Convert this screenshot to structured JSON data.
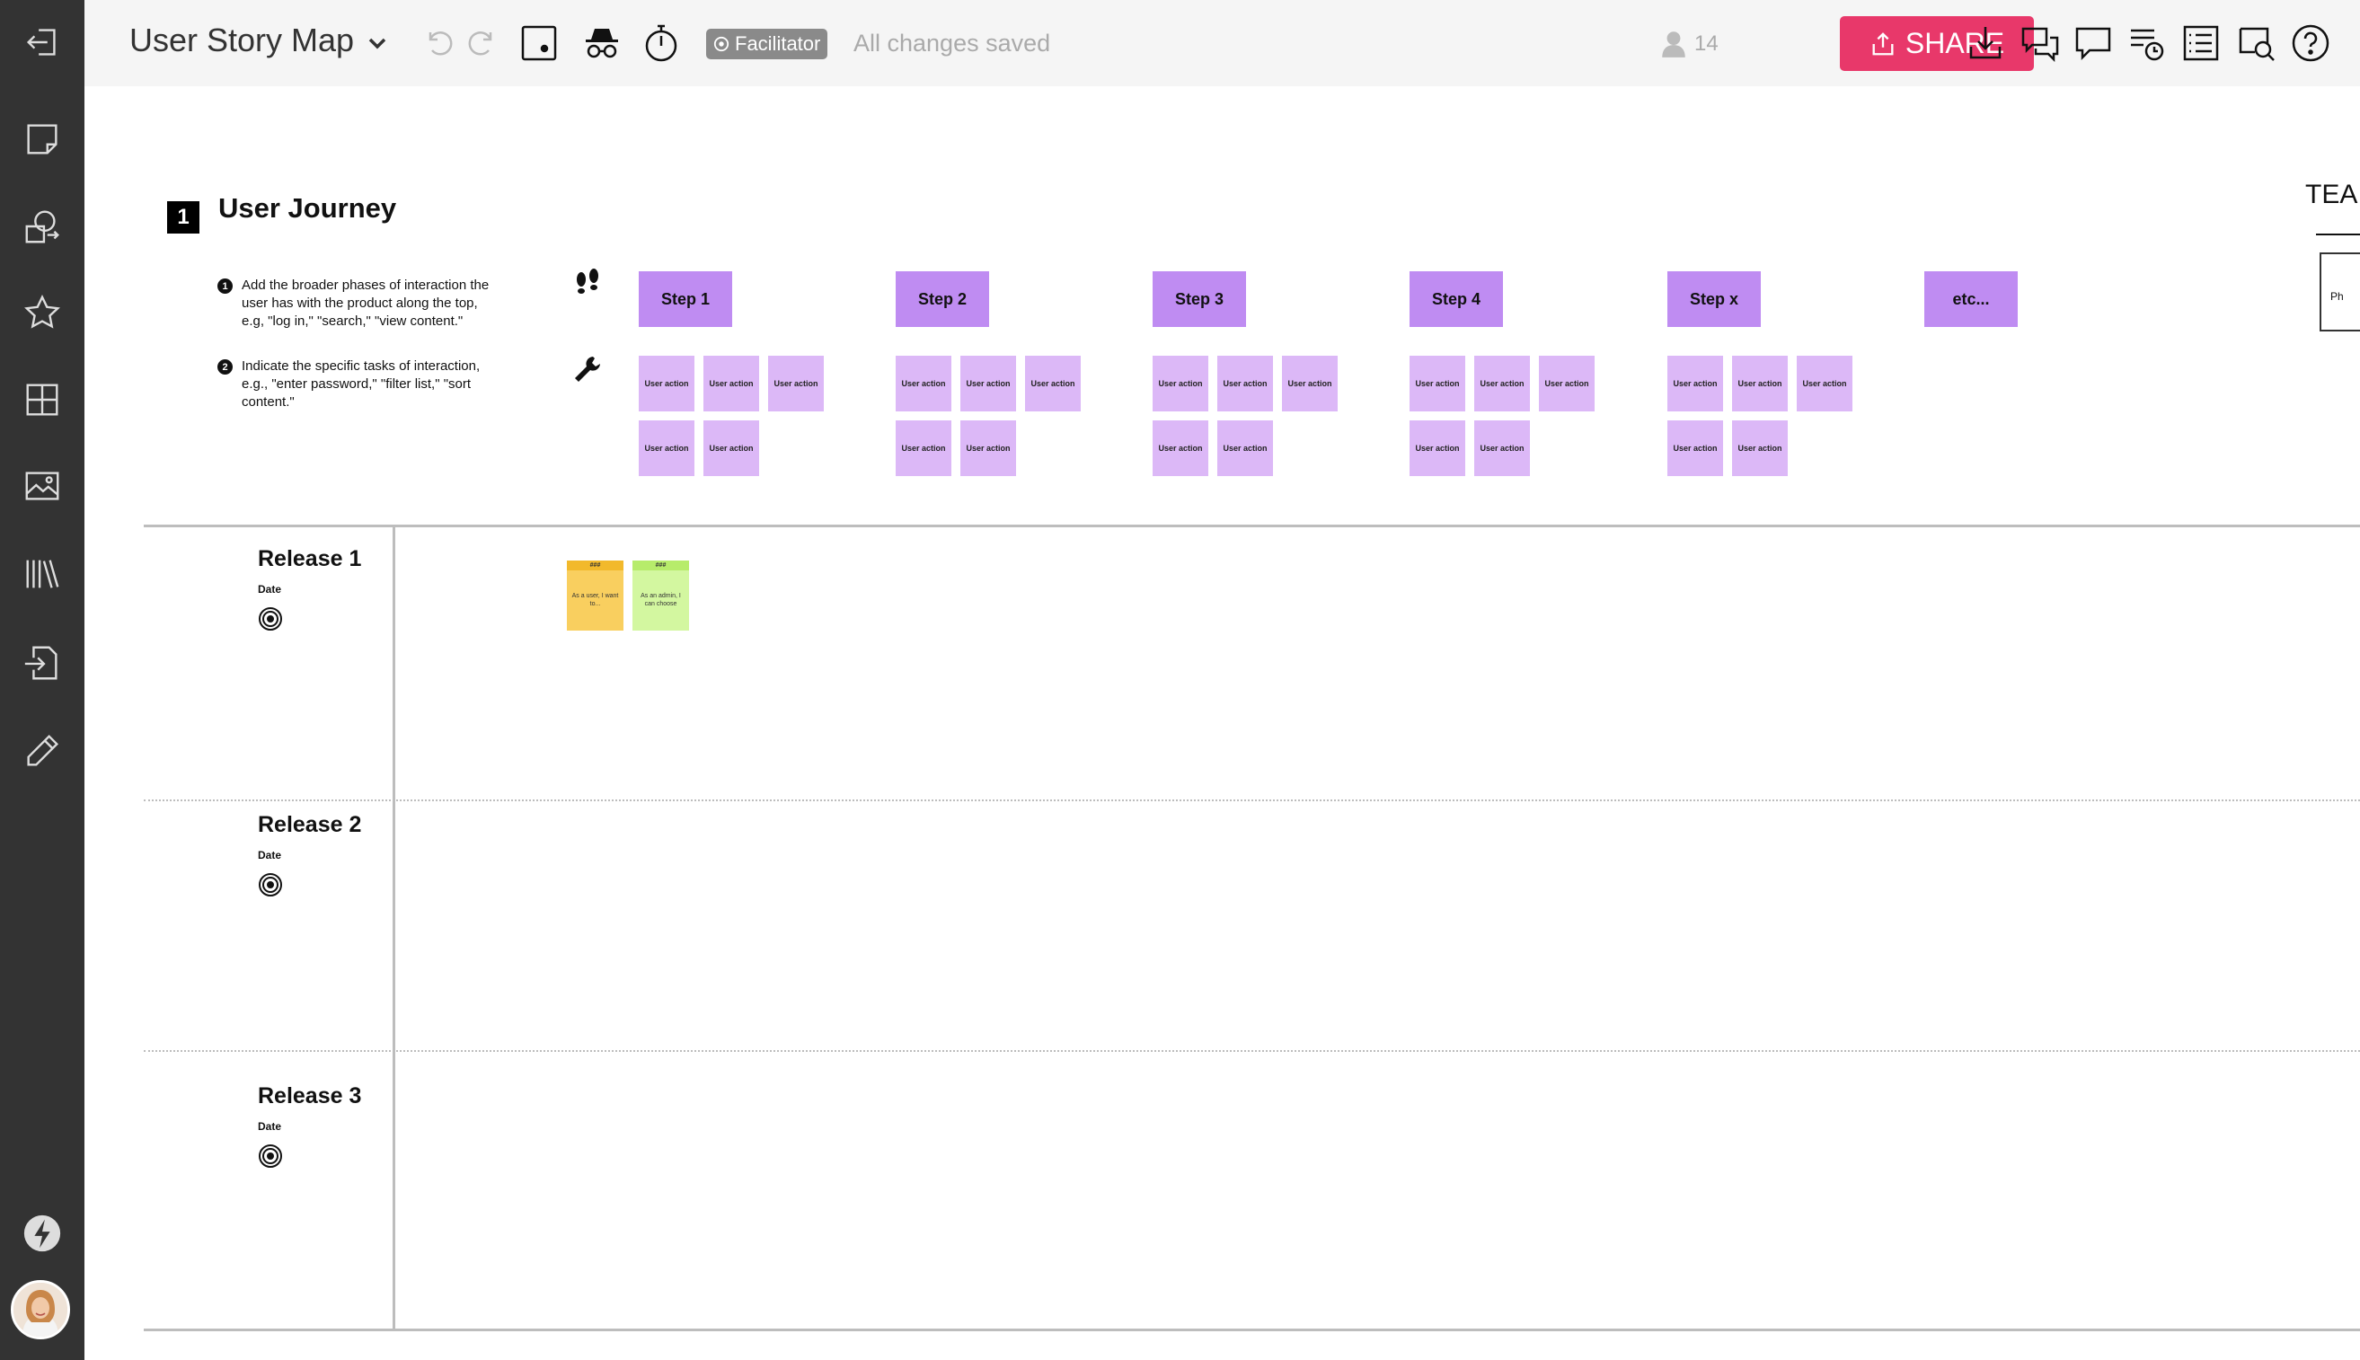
{
  "topbar": {
    "title": "User Story Map",
    "facilitator_label": "Facilitator",
    "save_status": "All changes saved",
    "user_count": "14",
    "share_label": "SHARE"
  },
  "journey": {
    "number": "1",
    "title": "User Journey",
    "instructions": [
      {
        "num": "1",
        "text": "Add the broader phases of interaction the user has with the product along the top, e.g, \"log in,\" \"search,\" \"view content.\""
      },
      {
        "num": "2",
        "text": "Indicate the specific tasks of interaction, e.g., \"enter password,\" \"filter list,\" \"sort content.\""
      }
    ],
    "steps": [
      "Step 1",
      "Step 2",
      "Step 3",
      "Step 4",
      "Step x",
      "etc..."
    ],
    "action_label": "User action",
    "team_heading": "TEA",
    "team_card_text": "Ph"
  },
  "releases": [
    {
      "name": "Release 1",
      "date_label": "Date"
    },
    {
      "name": "Release 2",
      "date_label": "Date"
    },
    {
      "name": "Release 3",
      "date_label": "Date"
    }
  ],
  "stickies": [
    {
      "tag": "###",
      "text": "As a user, I want to...",
      "color": "#f9cf5f",
      "tape": "#f2b92c"
    },
    {
      "tag": "###",
      "text": "As an admin, I can choose",
      "color": "#d3f7a0",
      "tape": "#b7ec6b"
    }
  ],
  "colors": {
    "share": "#e8386a",
    "step": "#bf8cf2",
    "action": "#dcb8f7",
    "sidebar": "#333333"
  }
}
